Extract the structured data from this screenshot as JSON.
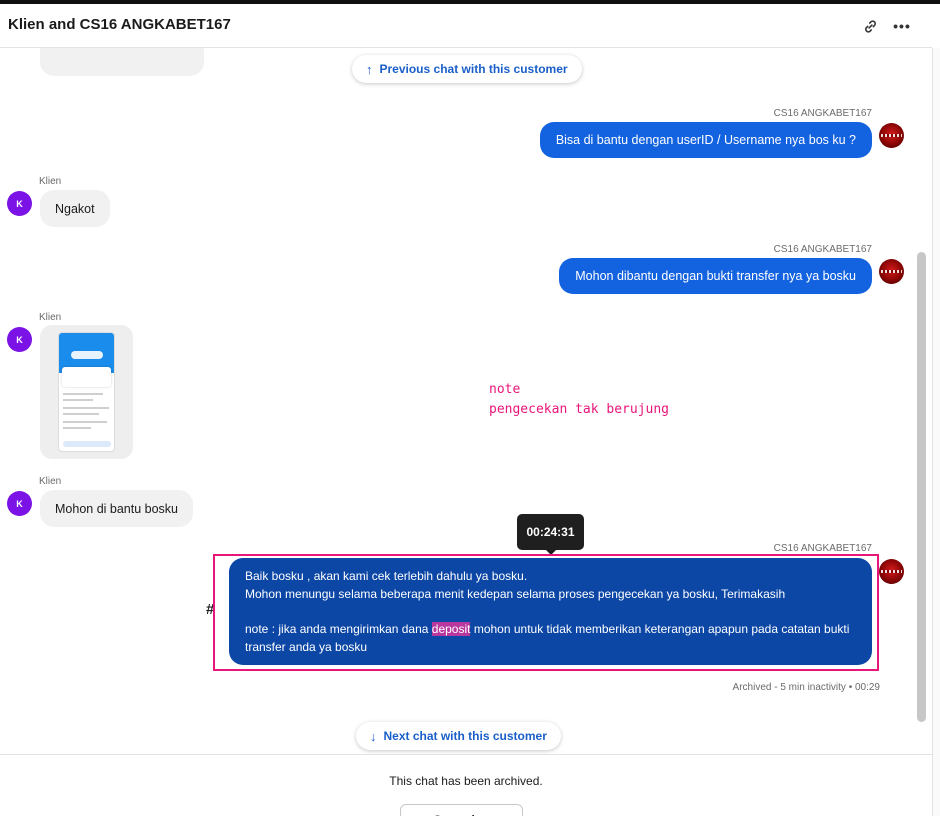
{
  "header": {
    "title": "Klien and CS16 ANGKABET167",
    "link_icon": "link-icon",
    "more_icon": "more-horizontal-icon"
  },
  "nav": {
    "previous_label": "Previous chat with this customer",
    "next_label": "Next chat with this customer"
  },
  "messages": [
    {
      "sender": "CS16 ANGKABET167",
      "text": "Bisa di bantu dengan userID / Username nya bos ku ?"
    },
    {
      "sender": "Klien",
      "text": "Ngakot",
      "avatar": "K"
    },
    {
      "sender": "CS16 ANGKABET167",
      "text": "Mohon dibantu dengan bukti transfer nya ya bosku"
    },
    {
      "sender": "Klien",
      "avatar": "K"
    },
    {
      "sender": "Klien",
      "text": "Mohon di bantu bosku",
      "avatar": "K"
    },
    {
      "sender": "CS16 ANGKABET167",
      "line1": "Baik bosku , akan kami cek terlebih dahulu ya bosku.",
      "line2": "Mohon menungu selama beberapa menit kedepan selama proses pengecekan ya bosku, Terimakasih",
      "line3_before": "note : jika anda mengirimkan dana ",
      "line3_highlight": "deposit",
      "line3_after": " mohon untuk tidak memberikan keterangan apapun pada catatan bukti",
      "line4": "transfer anda ya bosku"
    }
  ],
  "annotation": {
    "line1": "note",
    "line2": "pengecekan tak berujung",
    "hash": "#"
  },
  "tooltip": {
    "time": "00:24:31"
  },
  "archived_meta": "Archived - 5 min inactivity • 00:29",
  "footer": {
    "archived_text": "This chat has been archived.",
    "button_label": "Save chat"
  },
  "colors": {
    "accent_blue": "#1362e0",
    "highlight_bubble": "#0c47a6",
    "annotation_pink": "#e8167a",
    "avatar_purple": "#7b12e6"
  }
}
